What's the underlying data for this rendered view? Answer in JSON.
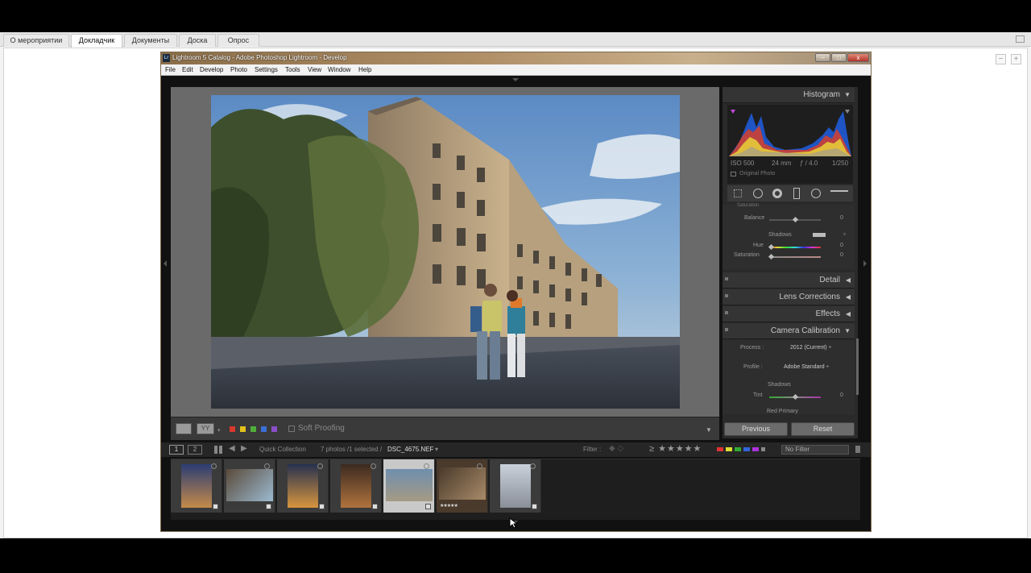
{
  "webinar": {
    "tabs": [
      {
        "label": "О мероприятии"
      },
      {
        "label": "Докладчик"
      },
      {
        "label": "Документы"
      },
      {
        "label": "Доска"
      },
      {
        "label": "Опрос"
      }
    ],
    "zoom_out": "−",
    "zoom_in": "+"
  },
  "window": {
    "logo": "Lr",
    "title": "Lightroom 5 Catalog - Adobe Photoshop Lightroom - Develop",
    "minimize": "–",
    "maximize": "□",
    "close": "x"
  },
  "menu": [
    "File",
    "Edit",
    "Develop",
    "Photo",
    "Settings",
    "Tools",
    "View",
    "Window",
    "Help"
  ],
  "toolbar": {
    "view_mode_label": "YY",
    "soft_proofing": "Soft Proofing",
    "color_labels": [
      "#d9382d",
      "#e2c21c",
      "#4fae3a",
      "#3a6fd6",
      "#8a4fc7"
    ]
  },
  "histogram": {
    "title": "Histogram",
    "iso": "ISO 500",
    "focal": "24 mm",
    "aperture": "ƒ / 4.0",
    "shutter": "1/250",
    "original_photo": "Original Photo"
  },
  "split_toning": {
    "saturation_top": "Saturation",
    "balance_label": "Balance",
    "balance_value": "0",
    "shadows_label": "Shadows",
    "hue_label": "Hue",
    "hue_value": "0",
    "saturation_label": "Saturation",
    "saturation_value": "0"
  },
  "panels": {
    "detail": "Detail",
    "lens": "Lens Corrections",
    "effects": "Effects",
    "calibration": "Camera Calibration"
  },
  "calibration": {
    "process_label": "Process :",
    "process_value": "2012 (Current) ÷",
    "profile_label": "Profile :",
    "profile_value": "Adobe Standard ÷",
    "shadows_label": "Shadows",
    "tint_label": "Tint",
    "tint_value": "0",
    "red_primary": "Red Primary"
  },
  "buttons": {
    "previous": "Previous",
    "reset": "Reset"
  },
  "filmstrip_bar": {
    "page1": "1",
    "page2": "2",
    "source": "Quick Collection",
    "count": "7 photos /1 selected /",
    "filename": "DSC_4675.NEF",
    "filter_label": "Filter :",
    "filter_value": "No Filter"
  },
  "filmstrip": {
    "thumbs": [
      {
        "name": "thumb-1",
        "palette": [
          "#2b3d73",
          "#c58a4a"
        ],
        "selected": false,
        "stars": ""
      },
      {
        "name": "thumb-2",
        "palette": [
          "#5a4a3a",
          "#9bbad0"
        ],
        "selected": false,
        "stars": ""
      },
      {
        "name": "thumb-3",
        "palette": [
          "#26314f",
          "#d8953e"
        ],
        "selected": false,
        "stars": ""
      },
      {
        "name": "thumb-4",
        "palette": [
          "#3b2a20",
          "#b0733d"
        ],
        "selected": false,
        "stars": ""
      },
      {
        "name": "thumb-5",
        "palette": [
          "#6f8fae",
          "#a59a84"
        ],
        "selected": true,
        "stars": ""
      },
      {
        "name": "thumb-6",
        "palette": [
          "#4a3a2c",
          "#a88a68"
        ],
        "selected": false,
        "stars": "★★★★★"
      },
      {
        "name": "thumb-7",
        "palette": [
          "#c9d1db",
          "#2a2a2a"
        ],
        "selected": false,
        "stars": ""
      }
    ]
  }
}
